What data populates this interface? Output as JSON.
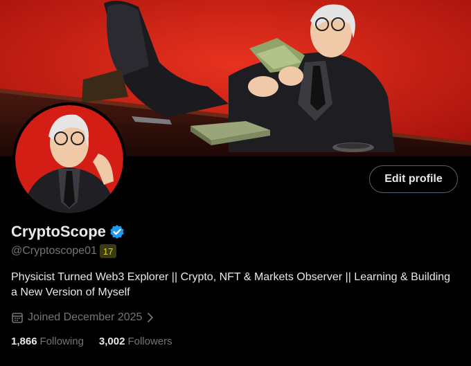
{
  "header": {
    "edit_profile_label": "Edit profile"
  },
  "profile": {
    "display_name": "CryptoScope",
    "handle": "@Cryptoscope01",
    "badge": "17",
    "bio": "Physicist Turned Web3 Explorer || Crypto, NFT & Markets Observer || Learning & Building a New Version of Myself",
    "joined": "Joined December 2025",
    "following_count": "1,866",
    "following_label": "Following",
    "followers_count": "3,002",
    "followers_label": "Followers"
  },
  "icons": {
    "verified": "verified-checkmark-icon",
    "calendar": "calendar-icon",
    "chevron": "chevron-right-icon"
  },
  "colors": {
    "background": "#000000",
    "banner_red": "#c81d14",
    "verified_blue": "#1d9bf0",
    "secondary_text": "#71767b",
    "badge_yellow": "#e9d800"
  }
}
